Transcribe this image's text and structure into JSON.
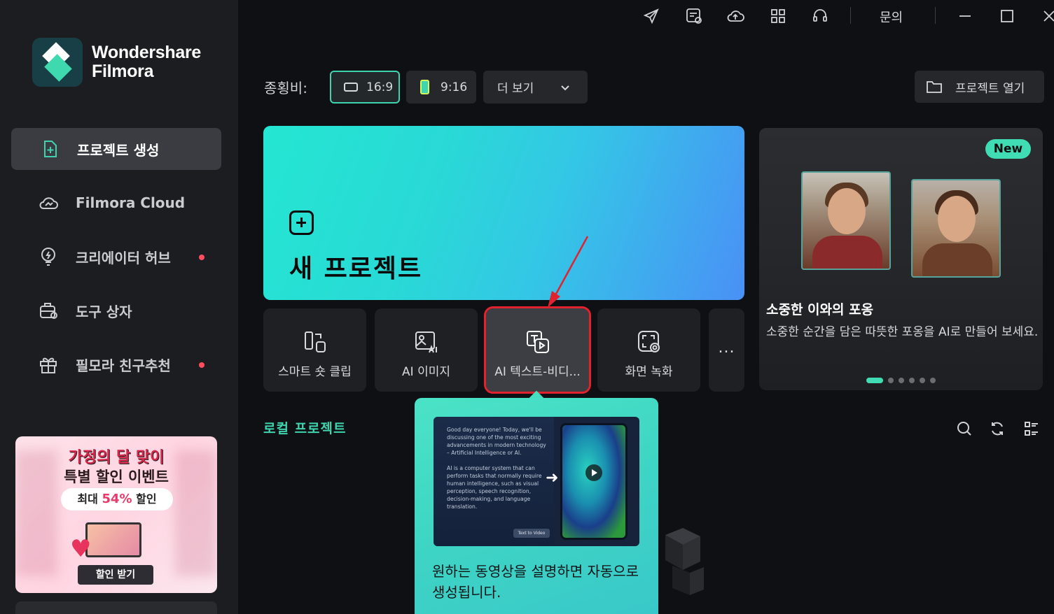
{
  "app": {
    "brand_line1": "Wondershare",
    "brand_line2": "Filmora"
  },
  "topbar": {
    "inquiry_label": "문의"
  },
  "sidebar": {
    "items": [
      {
        "label": "프로젝트 생성",
        "icon": "new-project-icon",
        "active": true
      },
      {
        "label": "Filmora Cloud",
        "icon": "cloud-icon"
      },
      {
        "label": "크리에이터 허브",
        "icon": "bulb-icon",
        "badge": true
      },
      {
        "label": "도구 상자",
        "icon": "toolbox-icon"
      },
      {
        "label": "필모라 친구추천",
        "icon": "gift-icon",
        "badge": true
      }
    ],
    "promo": {
      "line1": "가정의 달 맞이",
      "line2": "특별 할인 이벤트",
      "pill_prefix": "최대",
      "pill_value": "54%",
      "pill_suffix": "할인",
      "badge": "54%",
      "button": "할인 받기"
    }
  },
  "aspect": {
    "label": "종횡비:",
    "ratio_16_9": "16:9",
    "ratio_9_16": "9:16",
    "more": "더 보기",
    "open_project": "프로젝트 열기"
  },
  "new_project": {
    "label": "새 프로젝트"
  },
  "tools": [
    {
      "label": "스마트 숏 클립"
    },
    {
      "label": "AI 이미지"
    },
    {
      "label": "AI 텍스트-비디..."
    },
    {
      "label": "화면 녹화"
    },
    {
      "label": "..."
    }
  ],
  "feature": {
    "badge": "New",
    "title": "소중한 이와의 포옹",
    "description": "소중한 순간을 담은 따뜻한 포옹을 AI로 만들어 보세요."
  },
  "local": {
    "title": "로컬 프로젝트"
  },
  "tooltip": {
    "preview_text_1": "Good day everyone! Today, we'll be discussing one of the most exciting advancements in modern technology – Artificial Intelligence or AI.",
    "preview_text_2": "AI is a computer system that can perform tasks that normally require human intelligence, such as visual perception, speech recognition, decision-making, and language translation.",
    "preview_tag": "Text to Video",
    "description": "원하는 동영상을 설명하면 자동으로 생성됩니다."
  },
  "colors": {
    "accent": "#3fd4b0",
    "highlight_frame": "#e0232e",
    "badge_dot": "#ff4d5e"
  }
}
